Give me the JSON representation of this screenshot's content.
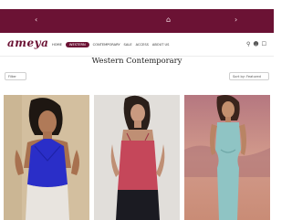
{
  "announcement": {
    "icons": [
      "chevron-left-icon",
      "home-icon",
      "chevron-right-icon"
    ]
  },
  "header": {
    "logo": "ameya",
    "nav": [
      "HOME",
      "WESTERN",
      "CONTEMPORARY",
      "SALE",
      "ACCESS",
      "ABOUT US"
    ],
    "active_nav": "WESTERN",
    "icons": [
      "search-icon",
      "user-icon",
      "cart-icon"
    ]
  },
  "page": {
    "title": "Western Contemporary",
    "filter_label": "Filter",
    "sort_label": "Sort by: Featured"
  },
  "products": [
    {
      "image": "woman-blue-halter-top",
      "top_color": "#2a2ec8"
    },
    {
      "image": "woman-pink-camisole-top",
      "top_color": "#c5475a"
    },
    {
      "image": "woman-sage-green-dress",
      "top_color": "#8fc4c4"
    }
  ],
  "colors": {
    "brand": "#6b1234",
    "text": "#222222"
  }
}
